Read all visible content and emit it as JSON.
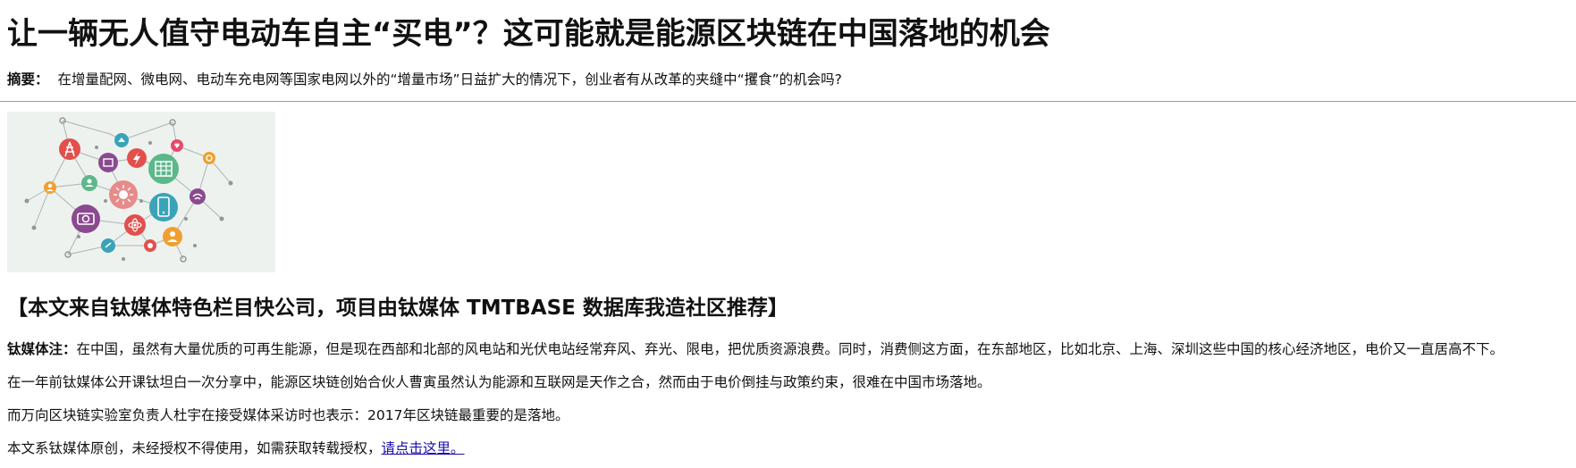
{
  "article": {
    "title": "让一辆无人值守电动车自主“买电”？这可能就是能源区块链在中国落地的机会",
    "abstract_label": "摘要：",
    "abstract_text": "在增量配网、微电网、电动车充电网等国家电网以外的“增量市场”日益扩大的情况下，创业者有从改革的夹缝中“攫食”的机会吗?",
    "subheading": "【本文来自钛媒体特色栏目快公司，项目由钛媒体 TMTBASE 数据库我造社区推荐】",
    "paragraphs": [
      {
        "lead": "钛媒体注：",
        "text": "在中国，虽然有大量优质的可再生能源，但是现在西部和北部的风电站和光伏电站经常弃风、弃光、限电，把优质资源浪费。同时，消费侧这方面，在东部地区，比如北京、上海、深圳这些中国的核心经济地区，电价又一直居高不下。"
      },
      {
        "text": "在一年前钛媒体公开课钛坦白一次分享中，能源区块链创始合伙人曹寅虽然认为能源和互联网是天作之合，然而由于电价倒挂与政策约束，很难在中国市场落地。"
      },
      {
        "text": "而万向区块链实验室负责人杜宇在接受媒体采访时也表示：2017年区块链最重要的是落地。"
      },
      {
        "text": "本文系钛媒体原创，未经授权不得使用，如需获取转载授权，",
        "link": "请点击这里。"
      }
    ]
  },
  "hero_image": {
    "icons": [
      "power-tower-icon",
      "lightning-icon",
      "building-icon",
      "solar-panel-icon",
      "phone-icon",
      "camera-icon",
      "atom-icon",
      "user-icon",
      "wifi-icon",
      "gear-icon",
      "house-icon",
      "heart-icon"
    ],
    "palette": [
      "#e2504c",
      "#5bb88a",
      "#3aa3b8",
      "#8a4a8f",
      "#f0a030",
      "#e88a8a"
    ]
  }
}
